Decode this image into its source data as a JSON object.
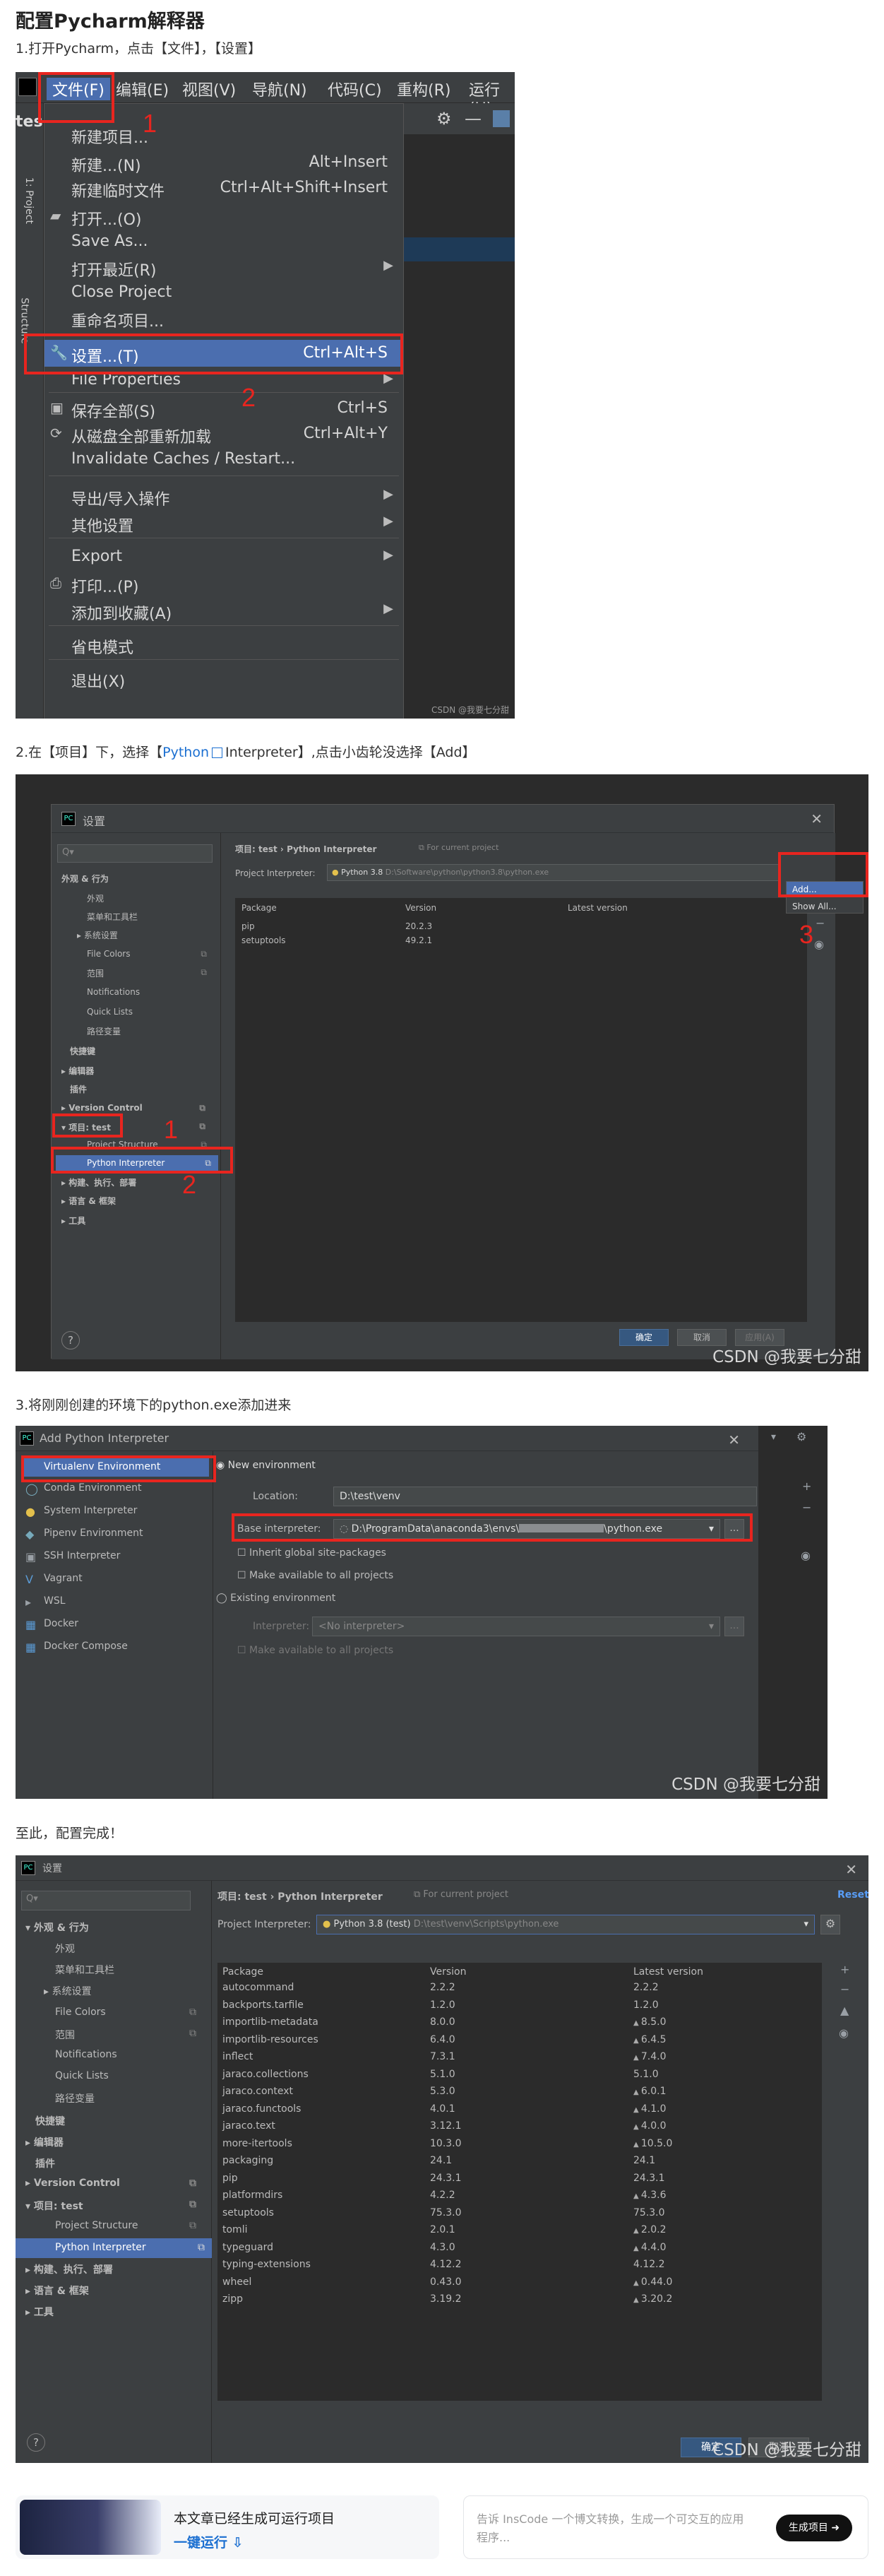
{
  "heading": "配置Pycharm解释器",
  "steps": {
    "s1": "1.打开Pycharm，点击【文件】，【设置】",
    "s2_pre": "2.在【项目】下，选择【",
    "s2_link": "Python",
    "s2_post": "Interpreter】,点击小齿轮没选择【Add】",
    "s3": "3.将刚刚创建的环境下的python.exe添加进来",
    "s4": "至此，配置完成！"
  },
  "shot1": {
    "menubar": [
      "文件(F)",
      "编辑(E)",
      "视图(V)",
      "导航(N)",
      "代码(C)",
      "重构(R)",
      "运行(U)"
    ],
    "items": [
      {
        "label": "新建项目...",
        "shortcut": ""
      },
      {
        "label": "新建...(N)",
        "shortcut": "Alt+Insert"
      },
      {
        "label": "新建临时文件",
        "shortcut": "Ctrl+Alt+Shift+Insert"
      },
      {
        "label": "打开...(O)",
        "shortcut": ""
      },
      {
        "label": "Save As...",
        "shortcut": ""
      },
      {
        "label": "打开最近(R)",
        "shortcut": ""
      },
      {
        "label": "Close Project",
        "shortcut": ""
      },
      {
        "label": "重命名项目...",
        "shortcut": ""
      },
      {
        "label": "设置...(T)",
        "shortcut": "Ctrl+Alt+S"
      },
      {
        "label": "File Properties",
        "shortcut": ""
      },
      {
        "label": "保存全部(S)",
        "shortcut": "Ctrl+S"
      },
      {
        "label": "从磁盘全部重新加载",
        "shortcut": "Ctrl+Alt+Y"
      },
      {
        "label": "Invalidate Caches / Restart...",
        "shortcut": ""
      },
      {
        "label": "导出/导入操作",
        "shortcut": ""
      },
      {
        "label": "其他设置",
        "shortcut": ""
      },
      {
        "label": "Export",
        "shortcut": ""
      },
      {
        "label": "打印...(P)",
        "shortcut": ""
      },
      {
        "label": "添加到收藏(A)",
        "shortcut": ""
      },
      {
        "label": "省电模式",
        "shortcut": ""
      },
      {
        "label": "退出(X)",
        "shortcut": ""
      }
    ],
    "badge1": "1",
    "badge2": "2",
    "side_tab": "1: Project",
    "side_tab2": "Structure",
    "frag": "tes",
    "watermark": "CSDN @我要七分甜"
  },
  "settings": {
    "window_title": "设置",
    "search_placeholder": "Q▾",
    "breadcrumb_project": "项目: test",
    "breadcrumb_sep": "›",
    "breadcrumb_page": "Python Interpreter",
    "for_current": "For current project",
    "interp_label": "Project Interpreter:",
    "tree": {
      "appearance": "外观 & 行为",
      "look": "外观",
      "menus": "菜单和工具栏",
      "system": "系统设置",
      "file_colors": "File Colors",
      "scopes": "范围",
      "notifications": "Notifications",
      "quick_lists": "Quick Lists",
      "path_vars": "路径变量",
      "keymap": "快捷键",
      "editor": "编辑器",
      "plugins": "插件",
      "vcs": "Version Control",
      "project": "项目: test",
      "structure": "Project Structure",
      "interpreter": "Python Interpreter",
      "build": "构建、执行、部署",
      "lang": "语言 & 框架",
      "tools": "工具"
    },
    "col_package": "Package",
    "col_version": "Version",
    "col_latest": "Latest version",
    "ok": "确定",
    "cancel": "取消",
    "apply": "应用(A)",
    "help": "?"
  },
  "shot2": {
    "interp_value": "Python 3.8",
    "interp_path": "D:\\Software\\python\\python3.8\\python.exe",
    "packages": [
      {
        "name": "pip",
        "version": "20.2.3",
        "latest": ""
      },
      {
        "name": "setuptools",
        "version": "49.2.1",
        "latest": ""
      }
    ],
    "add": "Add...",
    "show_all": "Show All...",
    "badge1": "1",
    "badge2": "2",
    "badge3": "3",
    "watermark": "CSDN @我要七分甜"
  },
  "shot3": {
    "window_title": "Add Python Interpreter",
    "types": [
      "Virtualenv Environment",
      "Conda Environment",
      "System Interpreter",
      "Pipenv Environment",
      "SSH Interpreter",
      "Vagrant",
      "WSL",
      "Docker",
      "Docker Compose"
    ],
    "new_env": "New environment",
    "location_label": "Location:",
    "location_value": "D:\\test\\venv",
    "base_label": "Base interpreter:",
    "base_value_pre": "D:\\ProgramData\\anaconda3\\envs\\",
    "base_value_post": "\\python.exe",
    "inherit": "Inherit global site-packages",
    "make_avail": "Make available to all projects",
    "existing": "Existing environment",
    "interp_label": "Interpreter:",
    "interp_value": "<No interpreter>",
    "make_avail2": "Make available to all projects",
    "browse": "...",
    "watermark": "CSDN @我要七分甜"
  },
  "shot4": {
    "interp_value": "Python 3.8 (test)",
    "interp_path": "D:\\test\\venv\\Scripts\\python.exe",
    "reset": "Reset",
    "packages": [
      {
        "name": "autocommand",
        "version": "2.2.2",
        "latest": "2.2.2",
        "up": false
      },
      {
        "name": "backports.tarfile",
        "version": "1.2.0",
        "latest": "1.2.0",
        "up": false
      },
      {
        "name": "importlib-metadata",
        "version": "8.0.0",
        "latest": "8.5.0",
        "up": true
      },
      {
        "name": "importlib-resources",
        "version": "6.4.0",
        "latest": "6.4.5",
        "up": true
      },
      {
        "name": "inflect",
        "version": "7.3.1",
        "latest": "7.4.0",
        "up": true
      },
      {
        "name": "jaraco.collections",
        "version": "5.1.0",
        "latest": "5.1.0",
        "up": false
      },
      {
        "name": "jaraco.context",
        "version": "5.3.0",
        "latest": "6.0.1",
        "up": true
      },
      {
        "name": "jaraco.functools",
        "version": "4.0.1",
        "latest": "4.1.0",
        "up": true
      },
      {
        "name": "jaraco.text",
        "version": "3.12.1",
        "latest": "4.0.0",
        "up": true
      },
      {
        "name": "more-itertools",
        "version": "10.3.0",
        "latest": "10.5.0",
        "up": true
      },
      {
        "name": "packaging",
        "version": "24.1",
        "latest": "24.1",
        "up": false
      },
      {
        "name": "pip",
        "version": "24.3.1",
        "latest": "24.3.1",
        "up": false
      },
      {
        "name": "platformdirs",
        "version": "4.2.2",
        "latest": "4.3.6",
        "up": true
      },
      {
        "name": "setuptools",
        "version": "75.3.0",
        "latest": "75.3.0",
        "up": false
      },
      {
        "name": "tomli",
        "version": "2.0.1",
        "latest": "2.0.2",
        "up": true
      },
      {
        "name": "typeguard",
        "version": "4.3.0",
        "latest": "4.4.0",
        "up": true
      },
      {
        "name": "typing-extensions",
        "version": "4.12.2",
        "latest": "4.12.2",
        "up": false
      },
      {
        "name": "wheel",
        "version": "0.43.0",
        "latest": "0.44.0",
        "up": true
      },
      {
        "name": "zipp",
        "version": "3.19.2",
        "latest": "3.20.2",
        "up": true
      }
    ],
    "watermark": "CSDN @我要七分甜"
  },
  "footer": {
    "card_text": "本文章已经生成可运行项目",
    "run_link": "一键运行",
    "prompt": "告诉 InsCode 一个博文转换，生成一个可交互的应用程序...",
    "gen_button": "生成项目"
  },
  "colors": {
    "accent_red": "#e8251f",
    "ide_bg": "#3c3f41",
    "select_blue": "#4b6eaf",
    "link": "#1b6fd1"
  }
}
